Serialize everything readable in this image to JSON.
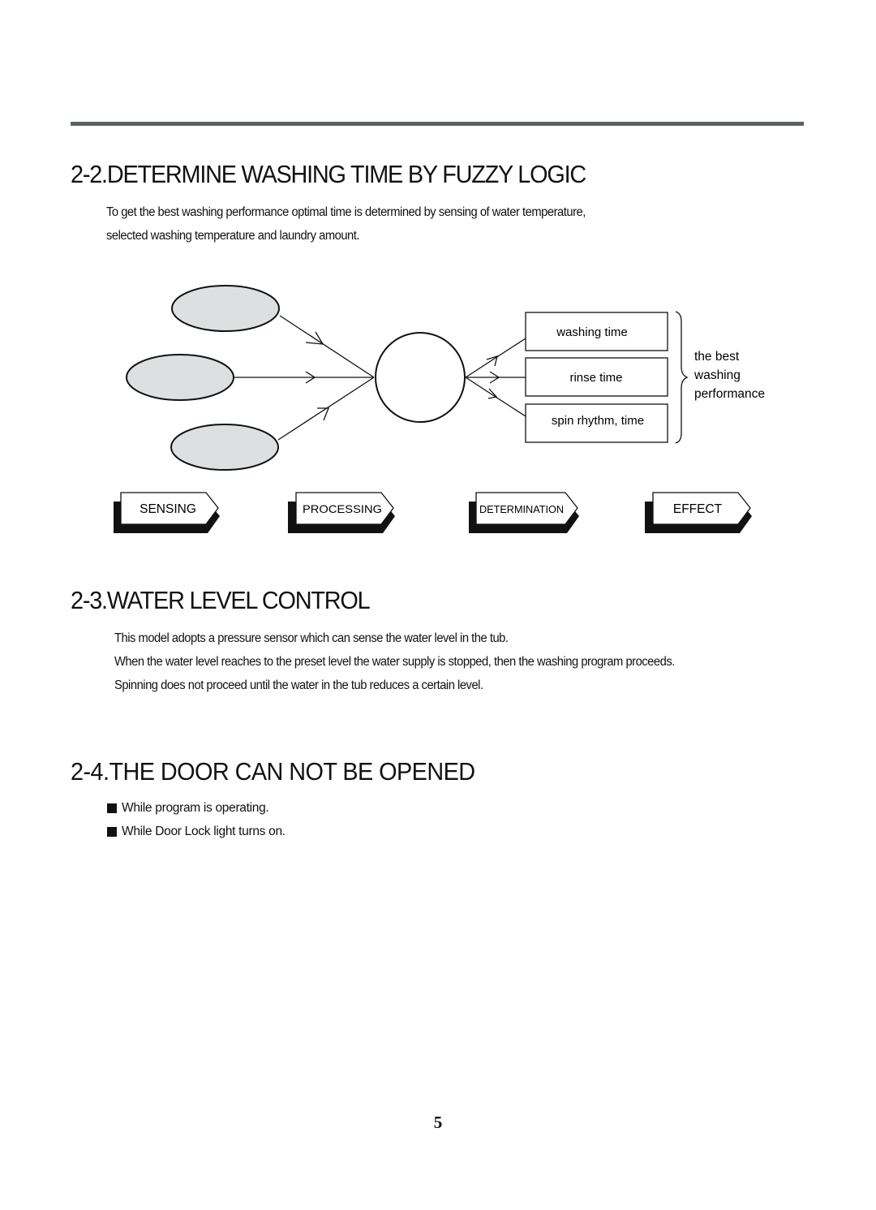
{
  "sections": [
    {
      "title": "2-2.DETERMINE WASHING TIME BY FUZZY LOGIC",
      "paragraph_lines": [
        "To get the best washing performance optimal time is determined by sensing of water temperature,",
        "selected washing temperature and laundry amount."
      ]
    },
    {
      "title": "2-3.WATER LEVEL CONTROL",
      "paragraph_lines": [
        "This model adopts a pressure sensor which can sense the water level in the tub.",
        "When the water level reaches to the preset level the water supply is stopped, then the washing program proceeds.",
        "Spinning does not proceed until the water in the tub reduces a certain level."
      ]
    },
    {
      "title": "2-4.THE DOOR CAN NOT BE OPENED",
      "bullets": [
        "While program is operating.",
        "While Door Lock light turns on."
      ]
    }
  ],
  "diagram": {
    "outputs": [
      "washing time",
      "rinse time",
      "spin rhythm, time"
    ],
    "effect_label_lines": [
      "the best",
      "washing",
      "performance"
    ],
    "stages": [
      "SENSING",
      "PROCESSING",
      "DETERMINATION",
      "EFFECT"
    ],
    "colors": {
      "ellipse_fill": "#dde0e0",
      "stroke": "#111111",
      "rule": "#5a6466"
    }
  },
  "page_number": "5"
}
